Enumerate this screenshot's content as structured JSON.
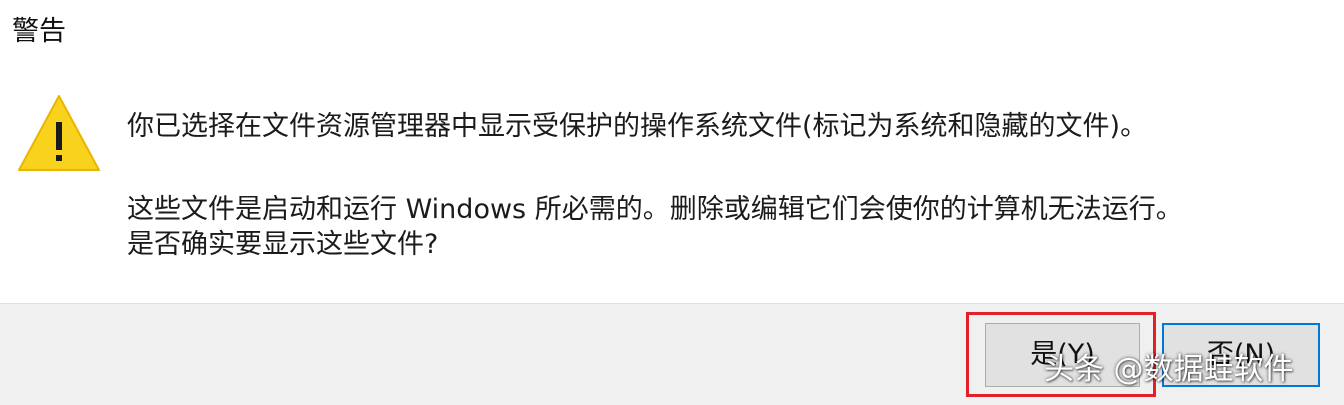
{
  "dialog": {
    "title": "警告",
    "icon": "warning-triangle-icon",
    "message_line1": "你已选择在文件资源管理器中显示受保护的操作系统文件(标记为系统和隐藏的文件)。",
    "message_line2": "这些文件是启动和运行 Windows 所必需的。删除或编辑它们会使你的计算机无法运行。",
    "message_line3": "是否确实要显示这些文件?"
  },
  "buttons": {
    "yes_label": "是(Y)",
    "no_label": "否(N)"
  },
  "colors": {
    "warning_fill": "#f8d21c",
    "highlight_border": "#e3202a",
    "focus_border": "#0078d7",
    "footer_bg": "#f0f0f0"
  },
  "watermark": {
    "text": "头条 @数据蛙软件"
  }
}
